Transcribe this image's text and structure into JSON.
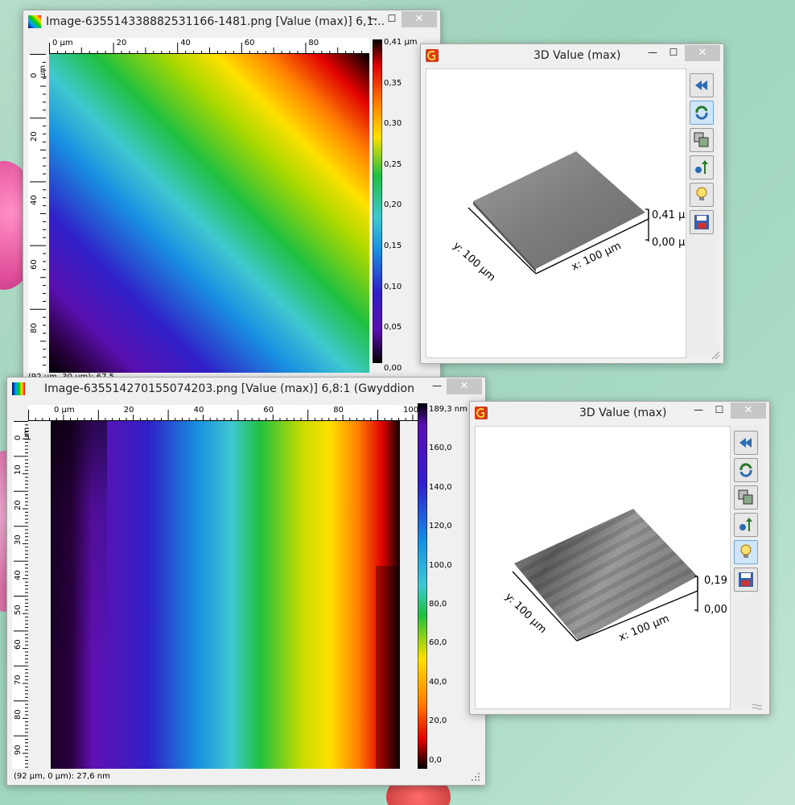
{
  "win1": {
    "title": "Image-635514338882531166-1481.png [Value (max)] 6,1:...",
    "ruler_h": [
      "0 µm",
      "20",
      "40",
      "60",
      "80"
    ],
    "ruler_v": [
      "0 µm",
      "20",
      "40",
      "60",
      "80"
    ],
    "colorbar": [
      "0,41 µm",
      "0,35",
      "0,30",
      "0,25",
      "0,20",
      "0,15",
      "0,10",
      "0,05",
      "0,00"
    ],
    "status": "(92 µm, 30 µm): 67,5"
  },
  "win2": {
    "title": "3D Value (max)",
    "z_max": "0,41 µ",
    "z_min": "0,00 µ",
    "y_axis": "y: 100 µm",
    "x_axis": "x: 100 µm"
  },
  "win3": {
    "title": "Image-635514270155074203.png [Value (max)] 6,8:1 (Gwyddion)",
    "ruler_h": [
      "0 µm",
      "20",
      "40",
      "60",
      "80",
      "100"
    ],
    "ruler_v": [
      "0 µm",
      "10",
      "20",
      "30",
      "40",
      "50",
      "60",
      "70",
      "80",
      "90"
    ],
    "colorbar": [
      "189,3 nm",
      "160,0",
      "140,0",
      "120,0",
      "100,0",
      "80,0",
      "60,0",
      "40,0",
      "20,0",
      "0,0"
    ],
    "status": "(92 µm, 0 µm): 27,6 nm"
  },
  "win4": {
    "title": "3D Value (max)",
    "z_max": "0,19",
    "z_min": "0,00",
    "y_axis": "y: 100 µm",
    "x_axis": "x: 100 µm"
  },
  "toolbar": [
    "reset-view",
    "rotate",
    "scale",
    "z-scale",
    "light",
    "save"
  ],
  "window_controls": {
    "minimize": "—",
    "maximize": "☐",
    "close": "✕"
  }
}
